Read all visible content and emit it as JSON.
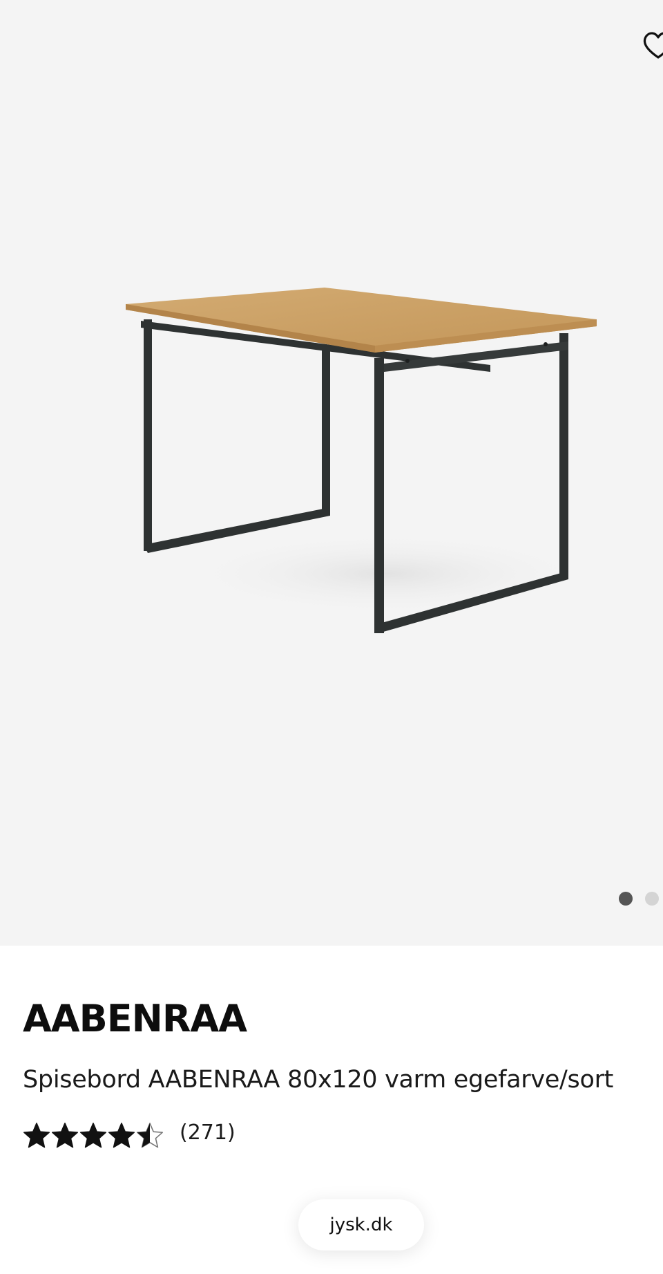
{
  "gallery": {
    "background": "#f4f4f4",
    "image_icon": "dining-table-photo",
    "wishlist_icon": "heart-outline-icon",
    "dots": {
      "count": 2,
      "active_index": 0
    }
  },
  "product": {
    "brand": "AABENRAA",
    "name": "Spisebord AABENRAA 80x120 varm egefarve/sort",
    "rating": {
      "value": 4.5,
      "max": 5,
      "count_label": "(271)"
    }
  },
  "browser": {
    "url": "jysk.dk"
  },
  "colors": {
    "star_fill": "#111111",
    "tabletop": "#c99e62",
    "frame": "#2e3232",
    "dot_active": "#555555",
    "dot_inactive": "#d4d4d4"
  }
}
